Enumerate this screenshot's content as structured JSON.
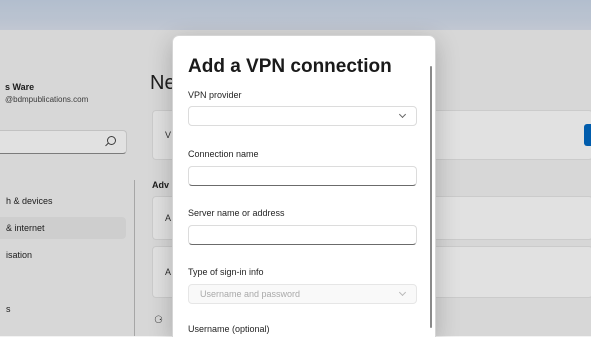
{
  "background": {
    "user": {
      "name": "s Ware",
      "email": "@bdmpublications.com"
    },
    "nav": {
      "bluetooth": "h & devices",
      "network": " & internet",
      "personalisation": "isation",
      "s_item": "s"
    },
    "page_heading": "Ne",
    "card1_label": "V",
    "advanced_label": "Adv",
    "card2_label": "A",
    "card3_label": "A"
  },
  "dialog": {
    "title": "Add a VPN connection",
    "vpn_provider": {
      "label": "VPN provider",
      "value": ""
    },
    "connection_name": {
      "label": "Connection name",
      "value": ""
    },
    "server": {
      "label": "Server name or address",
      "value": ""
    },
    "sign_in_type": {
      "label": "Type of sign-in info",
      "value": "Username and password"
    },
    "username": {
      "label": "Username (optional)"
    }
  },
  "colors": {
    "accent": "#0067c0"
  }
}
